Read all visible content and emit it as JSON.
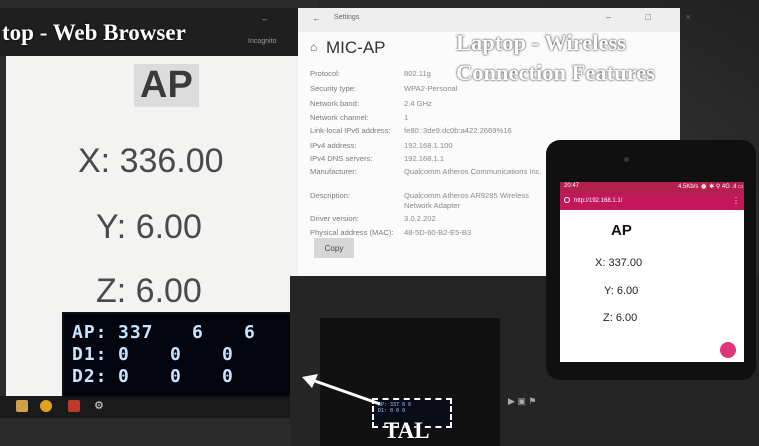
{
  "captions": {
    "browser": "top - Web Browser",
    "wireless": "Laptop - Wireless Connection Features",
    "tal": "TAL"
  },
  "browser": {
    "tab_text": "Incognito",
    "controls": "– □ ×",
    "ap_label": "AP",
    "x": "X: 336.00",
    "y": "Y: 6.00",
    "z": "Z: 6.00"
  },
  "oled": {
    "rows": [
      {
        "label": "AP:",
        "a": "337",
        "b": "6",
        "c": "6"
      },
      {
        "label": "D1:",
        "a": "0",
        "b": "0",
        "c": "0"
      },
      {
        "label": "D2:",
        "a": "0",
        "b": "0",
        "c": "0"
      }
    ]
  },
  "settings": {
    "window_title": "Settings",
    "network_name": "MIC-AP",
    "controls": "– □ ×",
    "properties": [
      {
        "label": "Protocol:",
        "value": "802.11g"
      },
      {
        "label": "Security type:",
        "value": "WPA2-Personal"
      },
      {
        "label": "Network band:",
        "value": "2.4 GHz"
      },
      {
        "label": "Network channel:",
        "value": "1"
      },
      {
        "label": "Link-local IPv6 address:",
        "value": "fe80::3de9:dc0b:a422:2669%16"
      },
      {
        "label": "IPv4 address:",
        "value": "192.168.1.100"
      },
      {
        "label": "IPv4 DNS servers:",
        "value": "192.168.1.1"
      },
      {
        "label": "Manufacturer:",
        "value": "Qualcomm Atheros Communications Inc."
      },
      {
        "label": "Description:",
        "value": "Qualcomm Atheros AR9285 Wireless Network Adapter"
      },
      {
        "label": "Driver version:",
        "value": "3.0.2.202"
      },
      {
        "label": "Physical address (MAC):",
        "value": "48-5D-60-B2-E5-B3"
      }
    ],
    "copy_button": "Copy"
  },
  "phone": {
    "time": "20:47",
    "status_icons": "4.5Kb/s ⏰ ✱ ⚲ 4G .ıl ▭",
    "url": "http://192.168.1.1/",
    "ap_label": "AP",
    "x": "X: 337.00",
    "y": "Y: 6.00",
    "z": "Z: 6.00"
  },
  "tal_screen": {
    "line1": "AP: 337  6  6",
    "line2": "D1: 0  0  0"
  }
}
